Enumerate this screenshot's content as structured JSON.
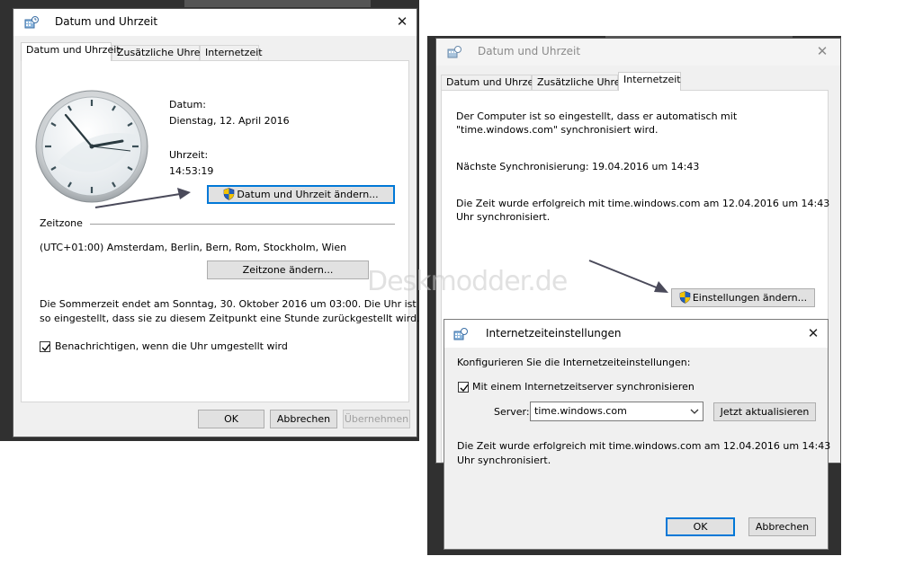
{
  "left_dialog": {
    "title": "Datum und Uhrzeit",
    "tabs": [
      {
        "label": "Datum und Uhrzeit",
        "active": true
      },
      {
        "label": "Zusätzliche Uhren",
        "active": false
      },
      {
        "label": "Internetzeit",
        "active": false
      }
    ],
    "date_label": "Datum:",
    "date_value": "Dienstag, 12. April 2016",
    "time_label": "Uhrzeit:",
    "time_value": "14:53:19",
    "change_datetime_button": "Datum und Uhrzeit ändern...",
    "timezone_heading": "Zeitzone",
    "timezone_value": "(UTC+01:00) Amsterdam, Berlin, Bern, Rom, Stockholm, Wien",
    "change_timezone_button": "Zeitzone ändern...",
    "dst_line1": "Die Sommerzeit endet am Sonntag, 30. Oktober 2016 um 03:00. Die Uhr ist",
    "dst_line2": "so eingestellt, dass sie zu diesem Zeitpunkt eine Stunde zurückgestellt wird.",
    "notify_checkbox": {
      "label": "Benachrichtigen, wenn die Uhr umgestellt wird",
      "checked": true
    },
    "ok_button": "OK",
    "cancel_button": "Abbrechen",
    "apply_button": "Übernehmen"
  },
  "right_dialog": {
    "title": "Datum und Uhrzeit",
    "tabs": [
      {
        "label": "Datum und Uhrzeit",
        "active": false
      },
      {
        "label": "Zusätzliche Uhren",
        "active": false
      },
      {
        "label": "Internetzeit",
        "active": true
      }
    ],
    "sync_line1": "Der Computer ist so eingestellt, dass er automatisch mit",
    "sync_line2": "\"time.windows.com\" synchronisiert wird.",
    "next_sync": "Nächste Synchronisierung: 19.04.2016 um 14:43",
    "success_line1": "Die Zeit wurde erfolgreich mit time.windows.com am 12.04.2016 um 14:43",
    "success_line2": "Uhr synchronisiert.",
    "change_settings_button": "Einstellungen ändern..."
  },
  "internet_settings_dialog": {
    "title": "Internetzeiteinstellungen",
    "heading": "Konfigurieren Sie die Internetzeiteinstellungen:",
    "sync_checkbox": {
      "label": "Mit einem Internetzeitserver synchronisieren",
      "checked": true
    },
    "server_label": "Server:",
    "server_value": "time.windows.com",
    "update_button": "Jetzt aktualisieren",
    "success_line1": "Die Zeit wurde erfolgreich mit time.windows.com am 12.04.2016 um 14:43",
    "success_line2": "Uhr synchronisiert.",
    "ok_button": "OK",
    "cancel_button": "Abbrechen"
  },
  "watermark": "Deskmodder.de",
  "colors": {
    "focus_blue": "#0078d7",
    "arrow": "#4a4a5a",
    "shield_blue": "#1f5fbf",
    "shield_yellow": "#f2c200"
  }
}
